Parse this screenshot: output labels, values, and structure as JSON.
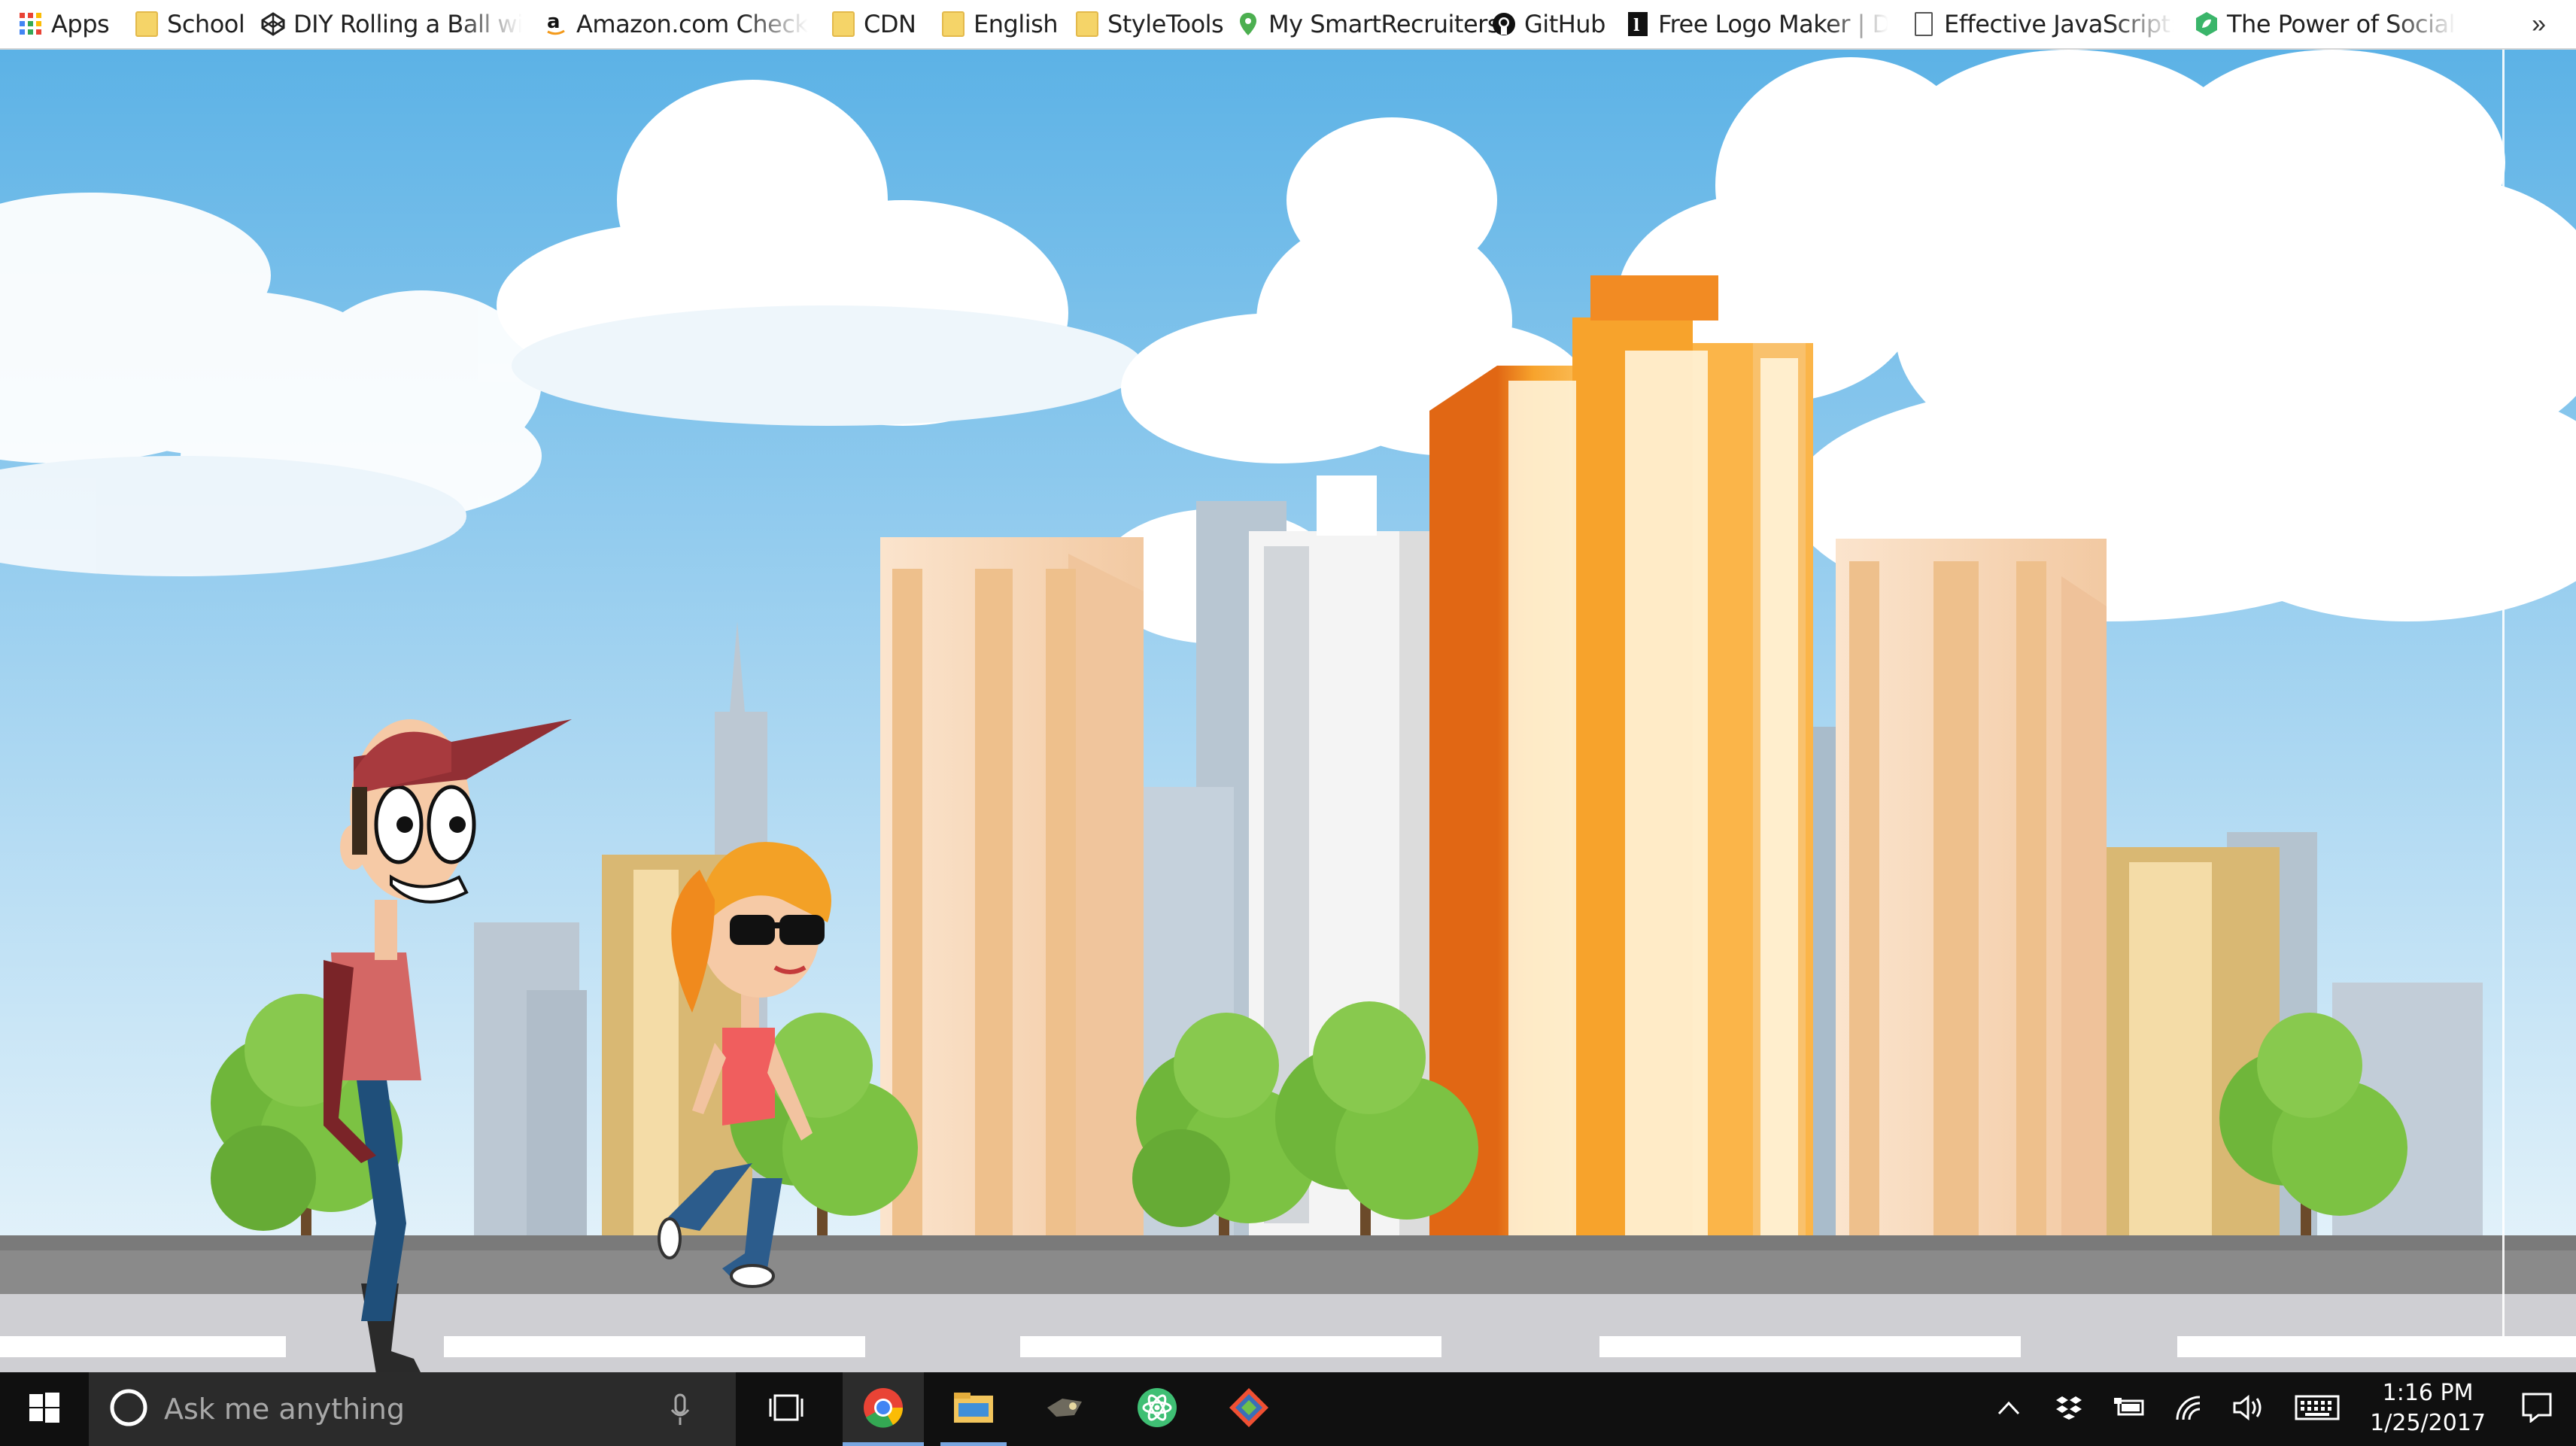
{
  "bookmarks": [
    {
      "label": "Apps",
      "icon": "apps-grid-icon"
    },
    {
      "label": "School",
      "icon": "folder-icon"
    },
    {
      "label": "DIY Rolling a Ball with",
      "icon": "codepen-icon"
    },
    {
      "label": "Amazon.com Checkou",
      "icon": "amazon-icon"
    },
    {
      "label": "CDN",
      "icon": "folder-icon"
    },
    {
      "label": "English",
      "icon": "folder-icon"
    },
    {
      "label": "StyleTools",
      "icon": "folder-icon"
    },
    {
      "label": "My SmartRecruiters",
      "icon": "location-pin-icon"
    },
    {
      "label": "GitHub",
      "icon": "github-icon"
    },
    {
      "label": "Free Logo Maker | De",
      "icon": "logo-maker-icon"
    },
    {
      "label": "Effective JavaScript: Fr",
      "icon": "page-icon"
    },
    {
      "label": "The Power of Social M",
      "icon": "hex-leaf-icon"
    }
  ],
  "overflow_label": "»",
  "taskbar": {
    "search_placeholder": "Ask me anything",
    "time": "1:16 PM",
    "date": "1/25/2017",
    "apps": [
      "chrome-icon",
      "file-explorer-icon",
      "game-icon",
      "atom-icon",
      "git-icon"
    ]
  },
  "colors": {
    "sky_top": "#5eb3e6",
    "sky_bottom": "#d6ecf7",
    "road": "#8a8a8a",
    "sidewalk": "#cfcfd3",
    "taskbar": "#101010",
    "building_orange": "#f7a32c",
    "tree_green": "#7cc243"
  }
}
